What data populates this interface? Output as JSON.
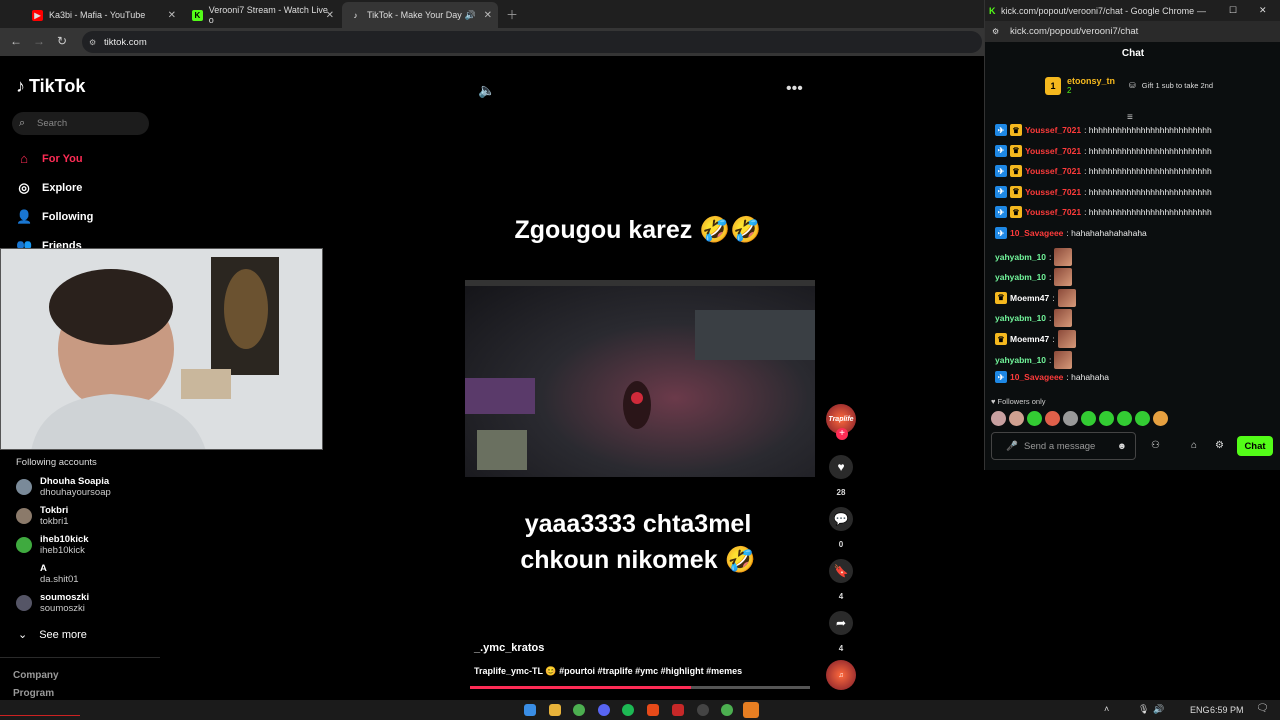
{
  "browser": {
    "tabs": [
      {
        "title": "Ka3bi - Mafia - YouTube",
        "color": "#ff0000"
      },
      {
        "title": "Verooni7 Stream - Watch Live o",
        "color": "#53fc18"
      },
      {
        "title": "TikTok - Make Your Day",
        "color": "#ffffff"
      }
    ],
    "url": "tiktok.com"
  },
  "tiktok": {
    "brand": "TikTok",
    "search_placeholder": "Search",
    "nav": [
      {
        "label": "For You",
        "active": true
      },
      {
        "label": "Explore"
      },
      {
        "label": "Following"
      },
      {
        "label": "Friends"
      }
    ],
    "following_title": "Following accounts",
    "accounts": [
      {
        "name": "Dhouha Soapia",
        "handle": "dhouhayoursoap"
      },
      {
        "name": "Tokbri",
        "handle": "tokbri1"
      },
      {
        "name": "iheb10kick",
        "handle": "iheb10kick"
      },
      {
        "name": "A",
        "handle": "da.shit01"
      },
      {
        "name": "soumoszki",
        "handle": "soumoszki"
      }
    ],
    "see_more": "See more",
    "footer": [
      "Company",
      "Program"
    ],
    "video": {
      "caption_top": "Zgougou karez 🤣🤣",
      "caption_bottom_1": "yaaa3333 chta3mel",
      "caption_bottom_2": "chkoun nikomek 🤣",
      "author": "_.ymc_kratos",
      "description": "Traplife_ymc-TL 😊 #pourtoi #traplife #ymc #highlight #memes",
      "likes": "28",
      "comments": "0",
      "saves": "4",
      "shares": "4",
      "progress": 0.65,
      "channel_tag": "Traplife"
    }
  },
  "kick": {
    "window_title": "kick.com/popout/verooni7/chat - Google Chrome",
    "url": "kick.com/popout/verooni7/chat",
    "chat_title": "Chat",
    "pinned_user": "etoonsy_tn",
    "pinned_count": "2",
    "gift_text": "Gift 1 sub to take 2nd",
    "messages": [
      {
        "user": "Youssef_7021",
        "text": ": hhhhhhhhhhhhhhhhhhhhhhhhhh",
        "color": "#ff3b3b"
      },
      {
        "user": "Youssef_7021",
        "text": ": hhhhhhhhhhhhhhhhhhhhhhhhhh",
        "color": "#ff3b3b"
      },
      {
        "user": "Youssef_7021",
        "text": ": hhhhhhhhhhhhhhhhhhhhhhhhhh",
        "color": "#ff3b3b"
      },
      {
        "user": "Youssef_7021",
        "text": ": hhhhhhhhhhhhhhhhhhhhhhhhhh",
        "color": "#ff3b3b"
      },
      {
        "user": "Youssef_7021",
        "text": ": hhhhhhhhhhhhhhhhhhhhhhhhhh",
        "color": "#ff3b3b"
      },
      {
        "user": "10_Savageee",
        "text": ": hahahahahahahaha",
        "color": "#ff3b3b"
      },
      {
        "user": "yahyabm_10",
        "text": ":",
        "color": "#72f59b"
      },
      {
        "user": "yahyabm_10",
        "text": ":",
        "color": "#72f59b"
      },
      {
        "user": "Moemn47",
        "text": ":",
        "color": "#ffffff"
      },
      {
        "user": "yahyabm_10",
        "text": ":",
        "color": "#72f59b"
      },
      {
        "user": "Moemn47",
        "text": ":",
        "color": "#ffffff"
      },
      {
        "user": "yahyabm_10",
        "text": ":",
        "color": "#72f59b"
      },
      {
        "user": "10_Savageee",
        "text": ": hahahaha",
        "color": "#ff3b3b"
      }
    ],
    "followers_only": "Followers only",
    "send_placeholder": "Send a message",
    "chat_button": "Chat"
  },
  "taskbar": {
    "lang": "ENG",
    "time": "6:59 PM"
  }
}
